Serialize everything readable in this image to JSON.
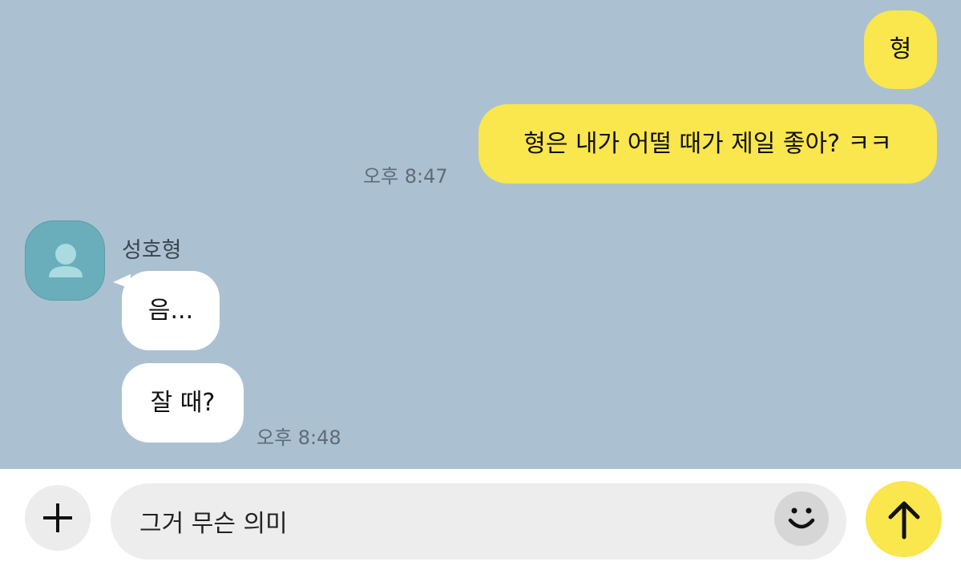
{
  "messages": {
    "sent_1": "형",
    "sent_2": "형은 내가 어떨 때가 제일 좋아? ㅋㅋ",
    "sent_time": "오후 8:47",
    "sender_name": "성호형",
    "received_1": "음...",
    "received_2": "잘 때?",
    "received_time": "오후 8:48"
  },
  "composer": {
    "input_value": "그거 무슨 의미",
    "plus_icon": "plus-icon",
    "emoji_icon": "smiley-icon",
    "send_icon": "arrow-up-icon"
  },
  "colors": {
    "background": "#abc1d1",
    "my_bubble": "#fae64d",
    "other_bubble": "#ffffff",
    "avatar": "#6aaebb"
  }
}
